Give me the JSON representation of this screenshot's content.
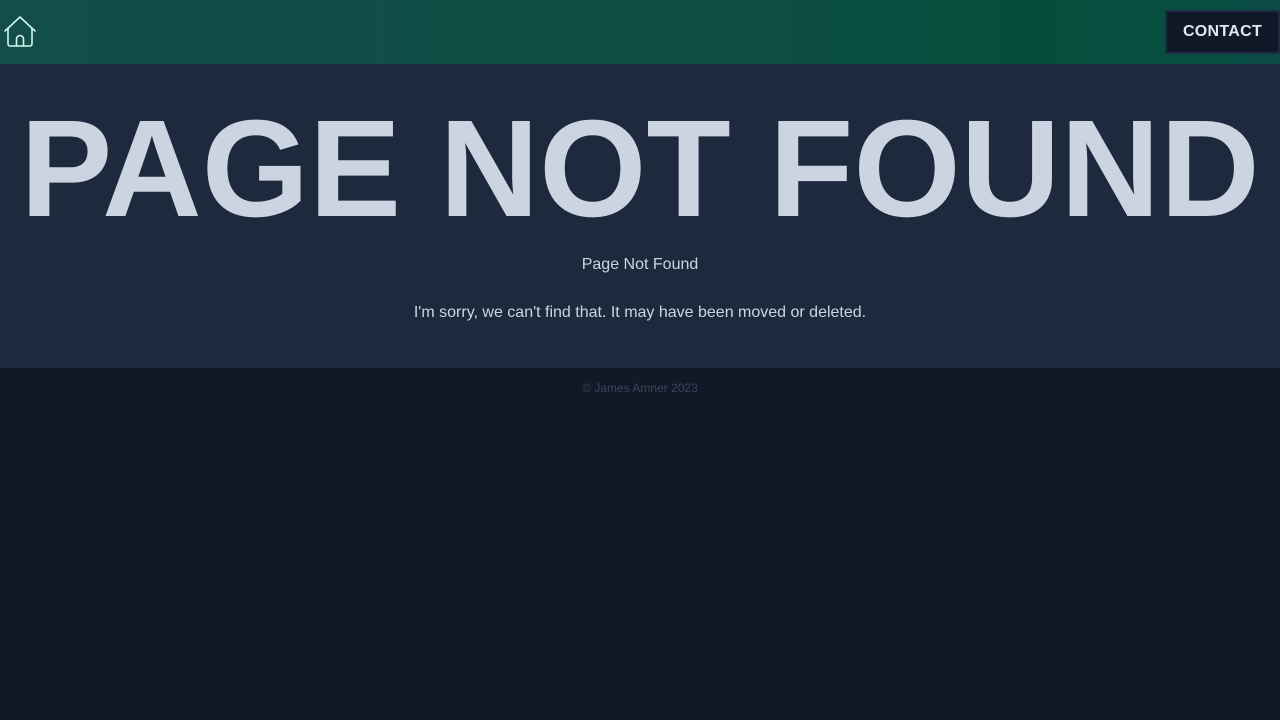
{
  "header": {
    "home_icon": "home-icon",
    "contact_label": "CONTACT"
  },
  "main": {
    "big_title": "PAGE NOT FOUND",
    "subtitle": "Page Not Found",
    "message": "I'm sorry, we can't find that. It may have been moved or deleted."
  },
  "footer": {
    "copyright": "© James Amner 2023"
  },
  "colors": {
    "header_gradient_start": "#134e4a",
    "header_gradient_end": "#064e3b",
    "main_background": "#1f293d",
    "page_background": "#111827",
    "text": "#cbd5e1"
  }
}
